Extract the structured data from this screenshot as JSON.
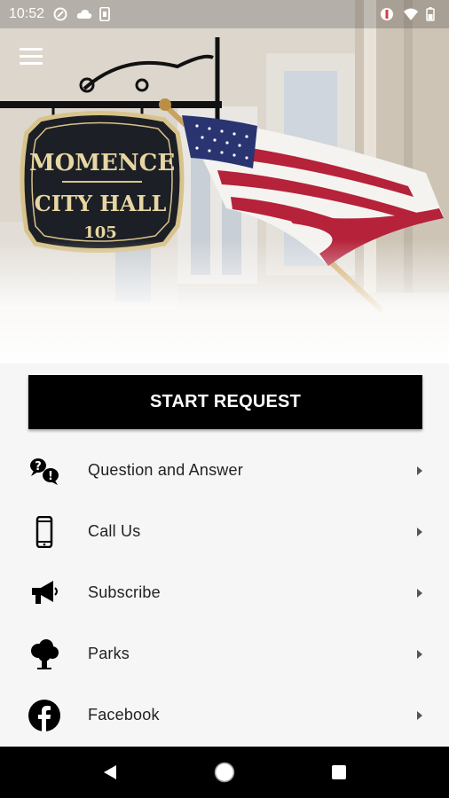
{
  "status_bar": {
    "time": "10:52",
    "left_icons": [
      "nfc-icon",
      "cloud-icon",
      "phone-icon"
    ],
    "right_icons": [
      "eye-icon",
      "wifi-icon",
      "battery-icon"
    ]
  },
  "hero": {
    "sign_line1": "MOMENCE",
    "sign_line2": "CITY HALL",
    "sign_line3": "105"
  },
  "start_request": {
    "label": "START REQUEST"
  },
  "menu": {
    "items": [
      {
        "label": "Question and Answer",
        "icon": "question-answer-icon"
      },
      {
        "label": "Call Us",
        "icon": "phone-icon"
      },
      {
        "label": "Subscribe",
        "icon": "megaphone-icon"
      },
      {
        "label": "Parks",
        "icon": "tree-icon"
      },
      {
        "label": "Facebook",
        "icon": "facebook-icon"
      }
    ]
  },
  "nav": {
    "buttons": [
      "back-icon",
      "home-icon",
      "recents-icon"
    ]
  }
}
